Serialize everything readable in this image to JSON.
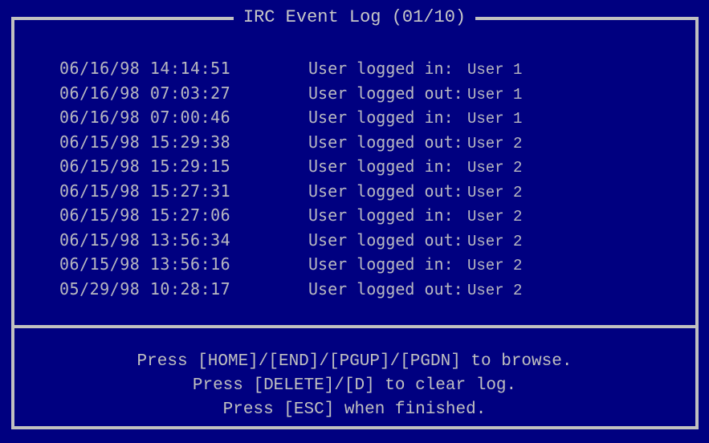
{
  "window": {
    "title": "IRC Event Log (01/10)"
  },
  "log": [
    {
      "timestamp": "06/16/98 14:14:51",
      "message": "User logged in:",
      "user": "User 1"
    },
    {
      "timestamp": "06/16/98 07:03:27",
      "message": "User logged out:",
      "user": "User 1"
    },
    {
      "timestamp": "06/16/98 07:00:46",
      "message": "User logged in:",
      "user": "User 1"
    },
    {
      "timestamp": "06/15/98 15:29:38",
      "message": "User logged out:",
      "user": "User 2"
    },
    {
      "timestamp": "06/15/98 15:29:15",
      "message": "User logged in:",
      "user": "User 2"
    },
    {
      "timestamp": "06/15/98 15:27:31",
      "message": "User logged out:",
      "user": "User 2"
    },
    {
      "timestamp": "06/15/98 15:27:06",
      "message": "User logged in:",
      "user": "User 2"
    },
    {
      "timestamp": "06/15/98 13:56:34",
      "message": "User logged out:",
      "user": "User 2"
    },
    {
      "timestamp": "06/15/98 13:56:16",
      "message": "User logged in:",
      "user": "User 2"
    },
    {
      "timestamp": "05/29/98 10:28:17",
      "message": "User logged out:",
      "user": "User 2"
    }
  ],
  "help": [
    "Press [HOME]/[END]/[PGUP]/[PGDN] to browse.",
    "Press [DELETE]/[D] to clear log.",
    "Press [ESC] when finished."
  ],
  "colors": {
    "background": "#000080",
    "border": "#c0c0c0",
    "text": "#c0c0c0"
  }
}
